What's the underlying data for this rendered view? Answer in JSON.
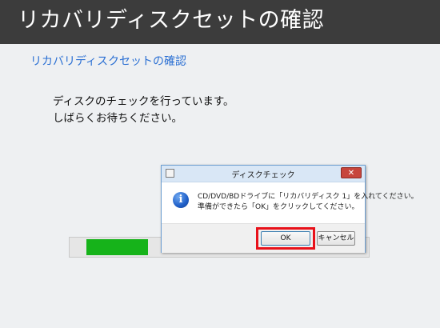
{
  "window": {
    "title": "リカバリディスクセットの確認"
  },
  "page": {
    "heading": "リカバリディスクセットの確認",
    "message_line1": "ディスクのチェックを行っています。",
    "message_line2": "しばらくお待ちください。"
  },
  "progress": {
    "value_percent": 22,
    "color": "#16b31a"
  },
  "dialog": {
    "title": "ディスクチェック",
    "close_glyph": "✕",
    "icon": "info-icon",
    "message_line1": "CD/DVD/BDドライブに「リカバリディスク 1」を入れてください。",
    "message_line2": "準備ができたら「OK」をクリックしてください。",
    "ok_label": "OK",
    "cancel_label": "キャンセル",
    "highlight_color": "#e8111a"
  }
}
